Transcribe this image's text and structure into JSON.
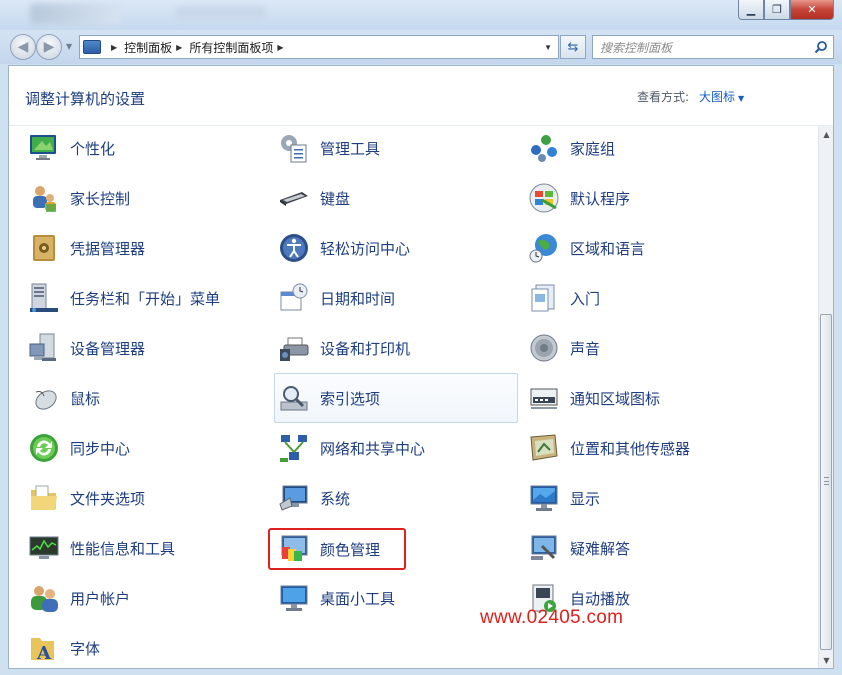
{
  "window": {
    "min_label": "▁",
    "max_label": "❐",
    "close_label": "✕"
  },
  "address": {
    "crumbs": [
      "控制面板",
      "所有控制面板项"
    ]
  },
  "search": {
    "placeholder": "搜索控制面板"
  },
  "header": {
    "title": "调整计算机的设置",
    "view_by_label": "查看方式:",
    "view_by_value": "大图标"
  },
  "items": [
    {
      "label": "个性化",
      "icon": "personalization-icon"
    },
    {
      "label": "管理工具",
      "icon": "admin-tools-icon"
    },
    {
      "label": "家庭组",
      "icon": "homegroup-icon"
    },
    {
      "label": "家长控制",
      "icon": "parental-controls-icon"
    },
    {
      "label": "键盘",
      "icon": "keyboard-icon"
    },
    {
      "label": "默认程序",
      "icon": "default-programs-icon"
    },
    {
      "label": "凭据管理器",
      "icon": "credential-manager-icon"
    },
    {
      "label": "轻松访问中心",
      "icon": "ease-of-access-icon"
    },
    {
      "label": "区域和语言",
      "icon": "region-language-icon"
    },
    {
      "label": "任务栏和「开始」菜单",
      "icon": "taskbar-icon"
    },
    {
      "label": "日期和时间",
      "icon": "date-time-icon"
    },
    {
      "label": "入门",
      "icon": "getting-started-icon"
    },
    {
      "label": "设备管理器",
      "icon": "device-manager-icon"
    },
    {
      "label": "设备和打印机",
      "icon": "devices-printers-icon"
    },
    {
      "label": "声音",
      "icon": "sound-icon"
    },
    {
      "label": "鼠标",
      "icon": "mouse-icon"
    },
    {
      "label": "索引选项",
      "icon": "indexing-options-icon"
    },
    {
      "label": "通知区域图标",
      "icon": "notification-icons-icon"
    },
    {
      "label": "同步中心",
      "icon": "sync-center-icon"
    },
    {
      "label": "网络和共享中心",
      "icon": "network-sharing-icon"
    },
    {
      "label": "位置和其他传感器",
      "icon": "location-sensors-icon"
    },
    {
      "label": "文件夹选项",
      "icon": "folder-options-icon"
    },
    {
      "label": "系统",
      "icon": "system-icon"
    },
    {
      "label": "显示",
      "icon": "display-icon"
    },
    {
      "label": "性能信息和工具",
      "icon": "performance-icon"
    },
    {
      "label": "颜色管理",
      "icon": "color-management-icon"
    },
    {
      "label": "疑难解答",
      "icon": "troubleshooting-icon"
    },
    {
      "label": "用户帐户",
      "icon": "user-accounts-icon"
    },
    {
      "label": "桌面小工具",
      "icon": "desktop-gadgets-icon"
    },
    {
      "label": "自动播放",
      "icon": "autoplay-icon"
    },
    {
      "label": "字体",
      "icon": "fonts-icon"
    }
  ],
  "watermark": "www.02405.com",
  "colors": {
    "link": "#1e3e80",
    "highlight_box": "#e0201e"
  }
}
